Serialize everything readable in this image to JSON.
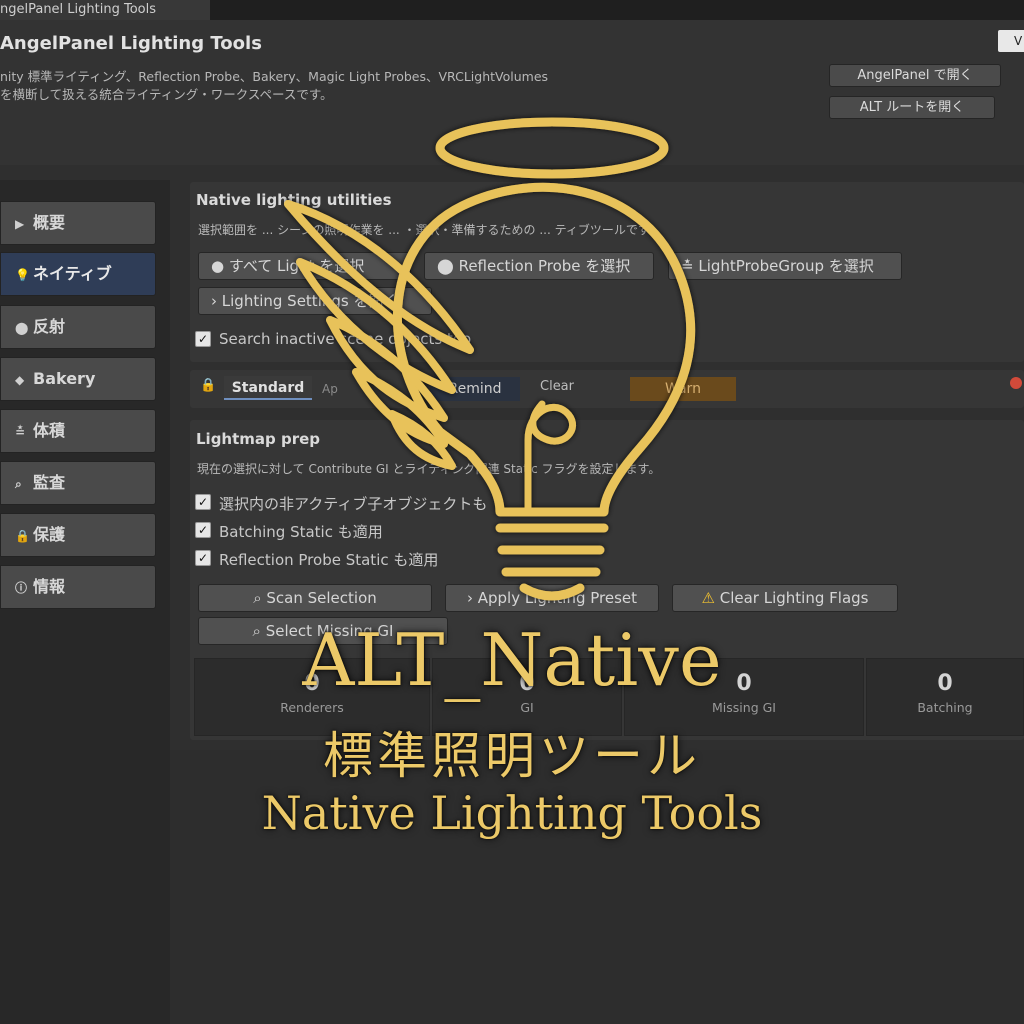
{
  "window": {
    "tab_title": "ngelPanel Lighting Tools",
    "title": "AngelPanel Lighting Tools",
    "description_lines": [
      "nity 標準ライティング、Reflection Probe、Bakery、Magic Light Probes、VRCLightVolumes",
      "を横断して扱える統合ライティング・ワークスペースです。"
    ],
    "open_angelpanel_button": "AngelPanel で開く",
    "open_alt_root_button": "ALT ルートを開く",
    "version_tab": "V"
  },
  "sidebar": {
    "items": [
      {
        "icon": "play-icon",
        "glyph": "▶",
        "label": "概要",
        "active": false
      },
      {
        "icon": "bulb-icon",
        "glyph": "💡",
        "label": "ネイティブ",
        "active": true
      },
      {
        "icon": "probe-icon",
        "glyph": "⬤",
        "label": "反射",
        "active": false
      },
      {
        "icon": "cube-icon",
        "glyph": "◆",
        "label": "Bakery",
        "active": false
      },
      {
        "icon": "volume-icon",
        "glyph": "≛",
        "label": "体積",
        "active": false
      },
      {
        "icon": "search-icon",
        "glyph": "⌕",
        "label": "監査",
        "active": false
      },
      {
        "icon": "lock-icon",
        "glyph": "🔒",
        "label": "保護",
        "active": false
      },
      {
        "icon": "info-icon",
        "glyph": "ⓘ",
        "label": "情報",
        "active": false
      }
    ]
  },
  "native": {
    "heading": "Native lighting utilities",
    "subtitle": "選択範囲を ... シーンの照明作業を ... ・選択・準備するための ... ティブツールです。",
    "btn_select_lights": "すべて Light を選択",
    "btn_select_reflection": "Reflection Probe を選択",
    "btn_select_lpg": "LightProbeGroup を選択",
    "btn_open_lighting": "Lighting Settings を開く",
    "checkbox_inactive": "Search inactive scene objects too"
  },
  "toolbar": {
    "standard": "Standard",
    "apply": "Ap",
    "remind": "Remind",
    "clear": "Clear",
    "warn": "Warn"
  },
  "lightmap": {
    "heading": "Lightmap prep",
    "subtitle": "現在の選択に対して Contribute GI とライティング関連 Static フラグを設定します。",
    "checks": [
      "選択内の非アクティブ子オブジェクトも",
      "Batching Static も適用",
      "Reflection Probe Static も適用"
    ],
    "btn_scan": "Scan Selection",
    "btn_apply_preset": "Apply Lighting Preset",
    "btn_clear_flags": "Clear Lighting Flags",
    "btn_select_missing": "Select Missing GI",
    "stats": [
      {
        "value": "0",
        "label": "Renderers"
      },
      {
        "value": "0",
        "label": "GI"
      },
      {
        "value": "0",
        "label": "Missing GI"
      },
      {
        "value": "0",
        "label": "Batching"
      }
    ]
  },
  "branding": {
    "title": "ALT_Native",
    "subtitle_jp": "標準照明ツール",
    "subtitle_en": "Native Lighting Tools",
    "logo_icon": "winged-halo-bulb-icon",
    "gold": "#ecc968"
  }
}
